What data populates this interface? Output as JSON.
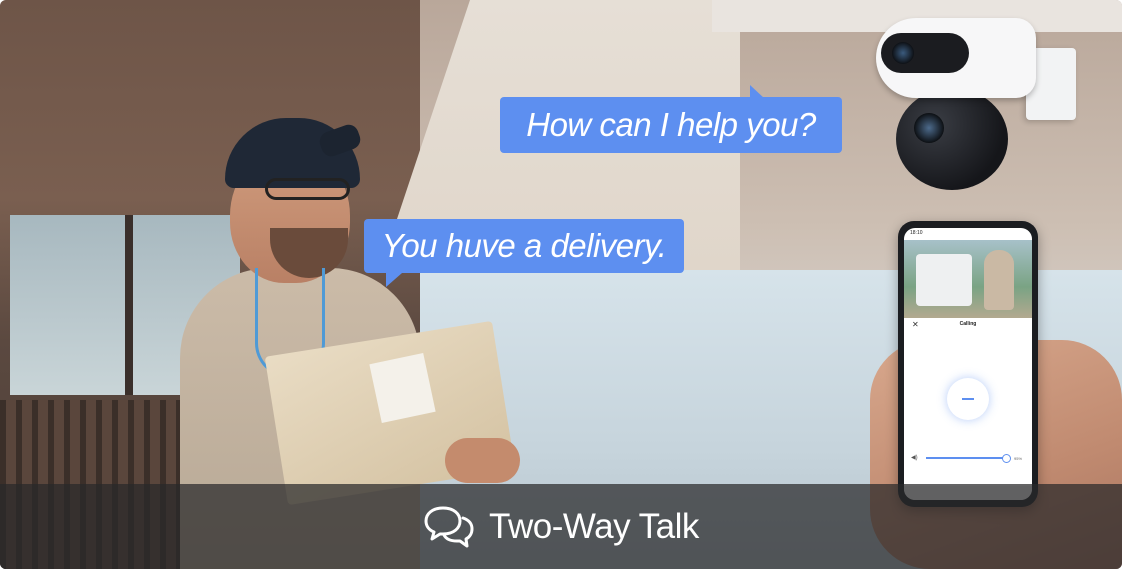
{
  "bubbles": {
    "camera_message": "How can I help you?",
    "person_message": "You huve a delivery."
  },
  "phone": {
    "status_time": "18:10",
    "screen_title": "Calling",
    "close_symbol": "✕",
    "volume_value": "95%"
  },
  "caption": {
    "icon": "speech-bubbles-icon",
    "text": "Two-Way Talk"
  },
  "colors": {
    "bubble": "#5d8ff0",
    "caption_bar": "#28282a"
  }
}
